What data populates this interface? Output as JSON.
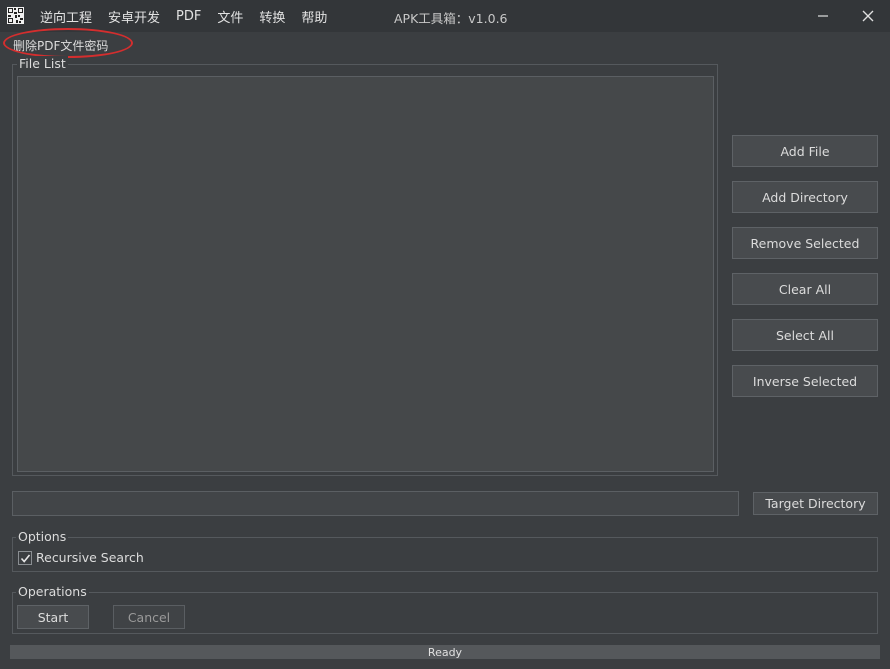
{
  "menu": {
    "items": [
      {
        "label": "逆向工程"
      },
      {
        "label": "安卓开发"
      },
      {
        "label": "PDF"
      },
      {
        "label": "文件"
      },
      {
        "label": "转换"
      },
      {
        "label": "帮助"
      }
    ]
  },
  "window": {
    "title": "APK工具箱：v1.0.6",
    "minimize_icon": "minimize-icon",
    "close_icon": "close-icon"
  },
  "section": {
    "title": "删除PDF文件密码",
    "highlight_color": "#d42e2e"
  },
  "file_list": {
    "label": "File List"
  },
  "side_buttons": {
    "add_file": "Add File",
    "add_directory": "Add Directory",
    "remove_selected": "Remove Selected",
    "clear_all": "Clear All",
    "select_all": "Select All",
    "inverse_selected": "Inverse Selected"
  },
  "target": {
    "value": "",
    "button_label": "Target Directory"
  },
  "options": {
    "label": "Options",
    "recursive_search": {
      "label": "Recursive Search",
      "checked": true
    }
  },
  "operations": {
    "label": "Operations",
    "start": "Start",
    "cancel": "Cancel"
  },
  "status": {
    "text": "Ready"
  },
  "colors": {
    "background": "#3b3e41",
    "titlebar": "#333639",
    "button": "#484b4e",
    "statusbar": "#55585b"
  }
}
